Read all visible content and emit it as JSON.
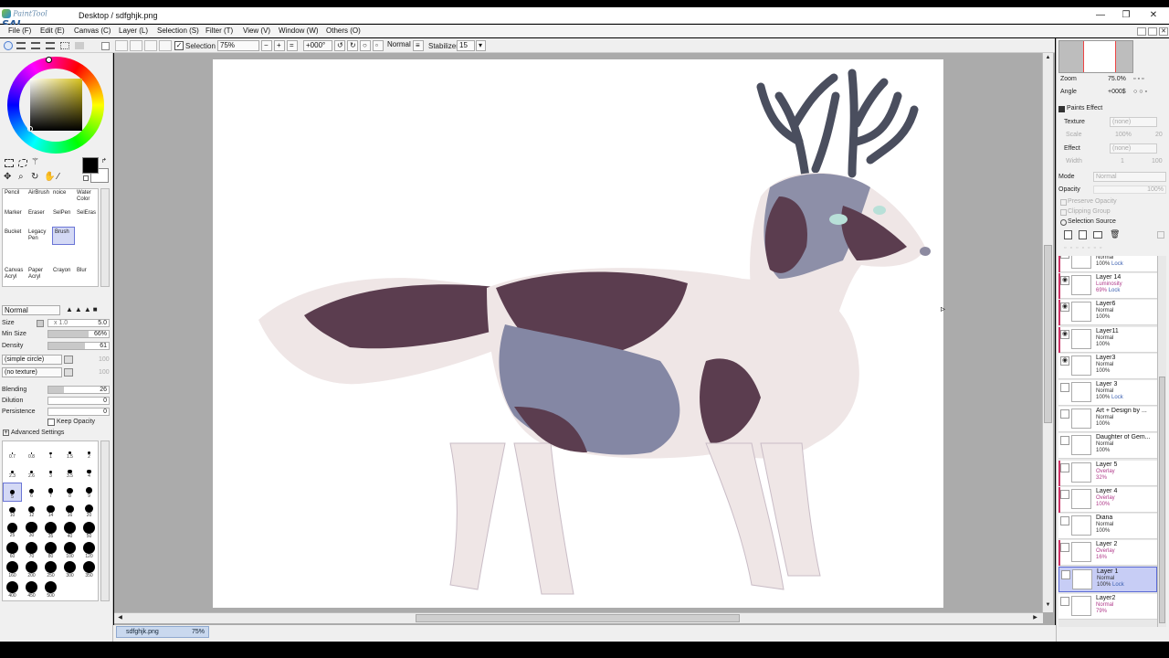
{
  "app": {
    "logo_small": "PaintTool",
    "logo_big": "SAI",
    "title": "Desktop / sdfghjk.png"
  },
  "window_buttons": {
    "minimize": "—",
    "maximize": "❐",
    "close": "✕"
  },
  "menu": [
    "File (F)",
    "Edit (E)",
    "Canvas (C)",
    "Layer (L)",
    "Selection (S)",
    "Filter (T)",
    "View (V)",
    "Window (W)",
    "Others (O)"
  ],
  "toolbar": {
    "selection": "Selection",
    "zoom": "75%",
    "rotation": "+000°",
    "blend": "Normal",
    "stabilizer_label": "Stabilizer",
    "stabilizer_value": "15"
  },
  "tools": {
    "row1": [
      "Pencil",
      "AirBrush",
      "noice",
      "Water Color"
    ],
    "row2": [
      "Marker",
      "Eraser",
      "SelPen",
      "SelEras"
    ],
    "row3": [
      "Bucket",
      "Legacy Pen",
      "Brush"
    ],
    "row4": [
      "Canvas Acryl",
      "Paper Acryl",
      "Crayon",
      "Blur"
    ]
  },
  "brush": {
    "mode": "Normal",
    "size_label": "Size",
    "size_mult": "x 1.0",
    "size_value": "5.0",
    "minsize_label": "Min Size",
    "minsize_value": "66%",
    "minsize_level": 0.66,
    "density_label": "Density",
    "density_value": "61",
    "density_level": 0.61,
    "shape": "(simple circle)",
    "shape_value": "100",
    "texture": "(no texture)",
    "texture_value": "100",
    "blending_label": "Blending",
    "blending_value": "26",
    "blending_level": 0.26,
    "dilution_label": "Dilution",
    "dilution_value": "0",
    "persistence_label": "Persistence",
    "persistence_value": "0",
    "keep_opacity": "Keep Opacity",
    "advanced": "Advanced Settings"
  },
  "brush_sizes": [
    "0.7",
    "0.8",
    "1",
    "1.5",
    "2",
    "2.3",
    "2.6",
    "3",
    "3.5",
    "4",
    "5",
    "6",
    "7",
    "8",
    "9",
    "10",
    "12",
    "14",
    "16",
    "20",
    "25",
    "30",
    "35",
    "40",
    "50",
    "60",
    "70",
    "80",
    "100",
    "120",
    "160",
    "200",
    "250",
    "300",
    "350",
    "400",
    "450",
    "500"
  ],
  "right_panel": {
    "zoom_label": "Zoom",
    "zoom_value": "75.0%",
    "angle_label": "Angle",
    "angle_value": "+000$",
    "paints_effect": "Paints Effect",
    "texture_label": "Texture",
    "texture_value": "(none)",
    "scale_label": "Scale",
    "scale_value": "100%",
    "scale_num": "20",
    "effect_label": "Effect",
    "effect_value": "(none)",
    "width_label": "Width",
    "width_value": "1",
    "width_num": "100",
    "mode_label": "Mode",
    "mode_value": "Normal",
    "opacity_label": "Opacity",
    "opacity_value": "100%",
    "preserve_opacity": "Preserve Opacity",
    "clipping_group": "Clipping Group",
    "selection_source": "Selection Source"
  },
  "layers": [
    {
      "name": "Layer5",
      "mode": "Normal",
      "opacity": "100%",
      "lock": "Lock",
      "visible": true,
      "clip": true,
      "mode_pink": false
    },
    {
      "name": "Layer 14",
      "mode": "Luminosity",
      "opacity": "69%",
      "lock": "Lock",
      "visible": true,
      "clip": true,
      "mode_pink": true
    },
    {
      "name": "Layer6",
      "mode": "Normal",
      "opacity": "100%",
      "lock": "",
      "visible": true,
      "clip": true,
      "mode_pink": false
    },
    {
      "name": "Layer11",
      "mode": "Normal",
      "opacity": "100%",
      "lock": "",
      "visible": true,
      "clip": true,
      "mode_pink": false
    },
    {
      "name": "Layer3",
      "mode": "Normal",
      "opacity": "100%",
      "lock": "",
      "visible": true,
      "clip": false,
      "mode_pink": false
    },
    {
      "name": "Layer 3",
      "mode": "Normal",
      "opacity": "100%",
      "lock": "Lock",
      "visible": false,
      "clip": false,
      "mode_pink": false
    },
    {
      "name": "Art + Design by ...",
      "mode": "Normal",
      "opacity": "100%",
      "lock": "",
      "visible": false,
      "clip": false,
      "mode_pink": false
    },
    {
      "name": "Daughter of Gem...",
      "mode": "Normal",
      "opacity": "100%",
      "lock": "",
      "visible": false,
      "clip": false,
      "mode_pink": false
    },
    {
      "name": "Layer 5",
      "mode": "Overlay",
      "opacity": "32%",
      "lock": "",
      "visible": false,
      "clip": true,
      "mode_pink": true
    },
    {
      "name": "Layer 4",
      "mode": "Overlay",
      "opacity": "100%",
      "lock": "",
      "visible": false,
      "clip": true,
      "mode_pink": true
    },
    {
      "name": "Diana",
      "mode": "Normal",
      "opacity": "100%",
      "lock": "",
      "visible": false,
      "clip": false,
      "mode_pink": false
    },
    {
      "name": "Layer 2",
      "mode": "Overlay",
      "opacity": "16%",
      "lock": "",
      "visible": false,
      "clip": true,
      "mode_pink": true
    },
    {
      "name": "Layer 1",
      "mode": "Normal",
      "opacity": "100%",
      "lock": "Lock",
      "visible": false,
      "clip": false,
      "mode_pink": false,
      "selected": true
    },
    {
      "name": "Layer2",
      "mode": "Normal",
      "opacity": "79%",
      "lock": "",
      "visible": false,
      "clip": false,
      "mode_pink": true
    }
  ],
  "status": {
    "doc": "sdfghjk.png",
    "zoom": "75%"
  },
  "colors": {
    "primary": "#000000",
    "secondary": "#ffffff",
    "accent": "#5b6ad6"
  }
}
